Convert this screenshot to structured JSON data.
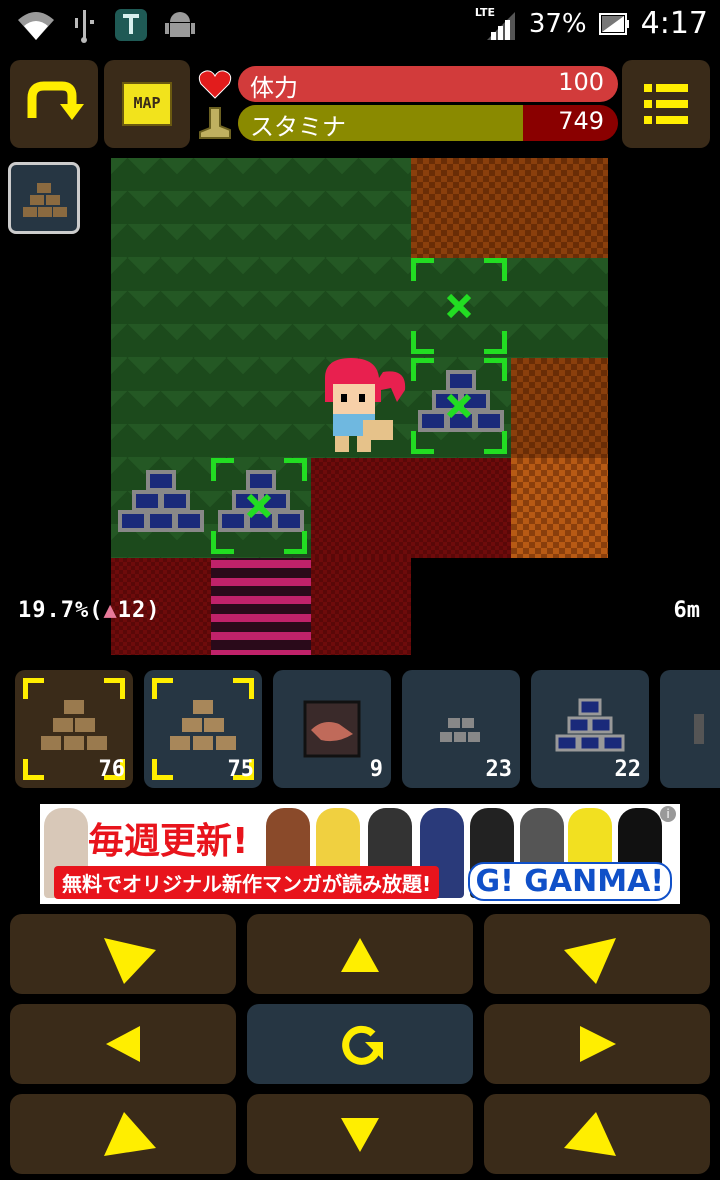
{
  "status_bar": {
    "network": "LTE",
    "battery": "37%",
    "time": "4:17",
    "icons": [
      "wifi-icon",
      "usb-icon",
      "shield-app-icon",
      "android-icon",
      "signal-icon",
      "battery-icon"
    ]
  },
  "hud": {
    "rotate_button": "rotate-arrow-icon",
    "map_button_label": "MAP",
    "menu_button": "menu-list-icon",
    "hp": {
      "label": "体力",
      "value": "100",
      "fraction": 1.0,
      "color": "#d23b3b",
      "icon": "heart-icon"
    },
    "stamina": {
      "label": "スタミナ",
      "value": "749",
      "fraction": 0.75,
      "color": "#8a8a00",
      "bg_color": "#8a0000",
      "icon": "boot-icon"
    }
  },
  "held_item": {
    "icon": "brown-block-pile-icon"
  },
  "map": {
    "progress_text": "19.7%(",
    "progress_count": "12)",
    "depth_text": "6m"
  },
  "inventory": [
    {
      "name": "brown-block-pile",
      "qty": "76",
      "selected": true
    },
    {
      "name": "brown-block-pile-light",
      "qty": "75",
      "selected": true
    },
    {
      "name": "ore-block",
      "qty": "9",
      "selected": false
    },
    {
      "name": "small-stone-pile",
      "qty": "23",
      "selected": false
    },
    {
      "name": "blue-block-pile",
      "qty": "22",
      "selected": false
    }
  ],
  "ad": {
    "title": "毎週更新!",
    "subtitle": "無料でオリジナル新作マンガが読み放題!",
    "brand": "G! GANMA!"
  },
  "dpad": [
    {
      "name": "dpad-down-right",
      "icon": "triangle-down-right-icon"
    },
    {
      "name": "dpad-up",
      "icon": "triangle-up-icon"
    },
    {
      "name": "dpad-down-left",
      "icon": "triangle-down-left-icon"
    },
    {
      "name": "dpad-left",
      "icon": "triangle-left-icon"
    },
    {
      "name": "dpad-rotate",
      "icon": "rotate-icon"
    },
    {
      "name": "dpad-right",
      "icon": "triangle-right-icon"
    },
    {
      "name": "dpad-up-right",
      "icon": "triangle-up-right-icon"
    },
    {
      "name": "dpad-down",
      "icon": "triangle-down-icon"
    },
    {
      "name": "dpad-up-left",
      "icon": "triangle-up-left-icon"
    }
  ],
  "colors": {
    "button_bg": "#3a2b19",
    "panel_bg": "#263643",
    "accent": "#ffee00",
    "selection": "#22dd22"
  }
}
